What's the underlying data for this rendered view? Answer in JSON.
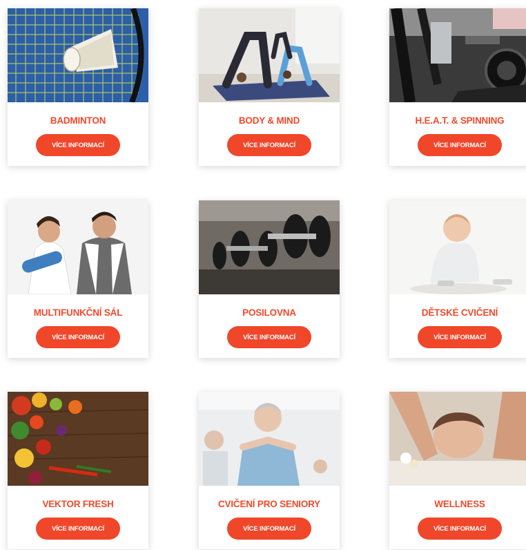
{
  "accent_color": "#f0462a",
  "button_label": "VÍCE INFORMACÍ",
  "cards": [
    {
      "title": "BADMINTON",
      "image": "badminton-shuttlecock-photo"
    },
    {
      "title": "BODY & MIND",
      "image": "yoga-class-photo"
    },
    {
      "title": "H.E.A.T. & SPINNING",
      "image": "spinning-bikes-photo"
    },
    {
      "title": "MULTIFUNKČNÍ SÁL",
      "image": "couple-with-yoga-mat-photo"
    },
    {
      "title": "POSILOVNA",
      "image": "dumbbells-rack-photo"
    },
    {
      "title": "DĚTSKÉ CVIČENÍ",
      "image": "baby-sitting-photo"
    },
    {
      "title": "VEKTOR FRESH",
      "image": "vegetables-on-table-photo"
    },
    {
      "title": "CVIČENÍ PRO SENIORY",
      "image": "seniors-exercise-photo"
    },
    {
      "title": "WELLNESS",
      "image": "massage-photo"
    }
  ]
}
